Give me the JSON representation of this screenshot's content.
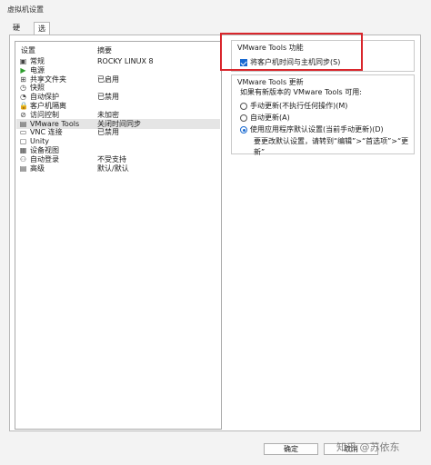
{
  "window": {
    "title": "虚拟机设置"
  },
  "tabs": [
    {
      "label": "硬件"
    },
    {
      "label": "选项"
    }
  ],
  "list": {
    "header": {
      "setting": "设置",
      "summary": "摘要"
    },
    "items": [
      {
        "name": "常规",
        "summary": "ROCKY LINUX 8",
        "icon": "general-icon",
        "glyph": "▣"
      },
      {
        "name": "电源",
        "summary": "",
        "icon": "power-play-icon",
        "glyph": "▶"
      },
      {
        "name": "共享文件夹",
        "summary": "已启用",
        "icon": "shared-folder-icon",
        "glyph": "⊞"
      },
      {
        "name": "快照",
        "summary": "",
        "icon": "snapshot-icon",
        "glyph": "◷"
      },
      {
        "name": "自动保护",
        "summary": "已禁用",
        "icon": "autoprotect-icon",
        "glyph": "◔"
      },
      {
        "name": "客户机隔离",
        "summary": "",
        "icon": "lock-icon",
        "glyph": "🔒"
      },
      {
        "name": "访问控制",
        "summary": "未加密",
        "icon": "access-control-icon",
        "glyph": "⊘"
      },
      {
        "name": "VMware Tools",
        "summary": "关闭时间同步",
        "icon": "vmware-tools-icon",
        "glyph": "▤"
      },
      {
        "name": "VNC 连接",
        "summary": "已禁用",
        "icon": "vnc-icon",
        "glyph": "▭"
      },
      {
        "name": "Unity",
        "summary": "",
        "icon": "unity-icon",
        "glyph": "▢"
      },
      {
        "name": "设备视图",
        "summary": "",
        "icon": "device-view-icon",
        "glyph": "▦"
      },
      {
        "name": "自动登录",
        "summary": "不受支持",
        "icon": "autologin-icon",
        "glyph": "⚇"
      },
      {
        "name": "高级",
        "summary": "默认/默认",
        "icon": "advanced-icon",
        "glyph": "▤"
      }
    ],
    "selected_index": 7
  },
  "tools_feature": {
    "title": "VMware Tools 功能",
    "sync_time_label": "将客户机时间与主机同步(S)",
    "sync_time_checked": true
  },
  "tools_update": {
    "title": "VMware Tools 更新",
    "prompt": "如果有新版本的 VMware Tools 可用:",
    "options": [
      {
        "label": "手动更新(不执行任何操作)(M)",
        "selected": false
      },
      {
        "label": "自动更新(A)",
        "selected": false
      },
      {
        "label": "使用应用程序默认设置(当前手动更新)(D)",
        "selected": true
      }
    ],
    "note": "要更改默认设置，请转到“编辑”>“首选项”>“更新”"
  },
  "buttons": {
    "ok": "确定",
    "cancel": "取消"
  },
  "watermark": "知乎 @苏依东",
  "colors": {
    "accent": "#1a6ad1",
    "highlight_box": "#d9262c"
  }
}
